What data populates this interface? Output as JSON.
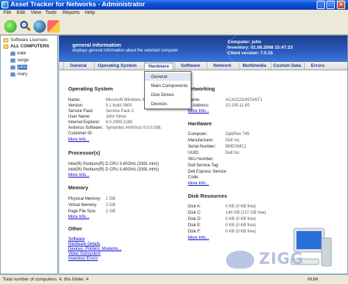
{
  "window": {
    "title": "Asset Tracker for Networks - Administrator"
  },
  "menu": [
    "File",
    "Edit",
    "View",
    "Tools",
    "Reports",
    "Help"
  ],
  "tree": {
    "items": [
      "Software Licenses",
      "ALL COMPUTERS",
      "kate",
      "serge",
      "john",
      "mary"
    ],
    "selected": "john"
  },
  "banner": {
    "title": "general information",
    "subtitle": "displays general information about the selected computer",
    "computer": "Computer: john",
    "inventory": "Inventory: 01.08.2008 15:47:23",
    "client_version": "Client version: 7.0.15"
  },
  "tabs": [
    "General",
    "Operating System",
    "Hardware",
    "Software",
    "Network",
    "Multimedia",
    "Custom Data",
    "Errors"
  ],
  "active_tab": "Hardware",
  "dropdown": [
    "General",
    "Main Components",
    "Disk Drives",
    "Devices"
  ],
  "os": {
    "title": "Operating System",
    "rows": [
      {
        "k": "Name:",
        "v": "Microsoft Windows XP"
      },
      {
        "k": "Version:",
        "v": "5.1 build 2600"
      },
      {
        "k": "Service Pack:",
        "v": "Service Pack 2"
      },
      {
        "k": "User Name:",
        "v": "John Silver"
      },
      {
        "k": "Internet Explorer:",
        "v": "6.0.2900.2180"
      },
      {
        "k": "Antivirus Software:",
        "v": "Symantec AntiVirus 9.0.0.338;"
      },
      {
        "k": "Customer ID:",
        "v": ""
      }
    ]
  },
  "processors": {
    "title": "Processor(s)",
    "rows": [
      "Intel(R) Pentium(R) D CPU 3.40GHz (3391 mHz)",
      "Intel(R) Pentium(R) D CPU 3.40GHz (3391 mHz)"
    ]
  },
  "memory": {
    "title": "Memory",
    "rows": [
      {
        "k": "Physical Memory:",
        "v": "1 GB"
      },
      {
        "k": "Virtual Memory:",
        "v": "2 GB"
      },
      {
        "k": "Page File Size:",
        "v": "2 GB"
      }
    ]
  },
  "other": {
    "title": "Other",
    "links": [
      "Software",
      "Hardware Details",
      "Devices, Printers, Modems...",
      "Video Subsystem",
      "Inventory Errors"
    ]
  },
  "more_info": "More Info...",
  "networking": {
    "title": "Networking",
    "rows": [
      {
        "k": "Name:",
        "v": "ACACCOUNTANT1"
      },
      {
        "k": "IP Address:",
        "v": "10.100.11.65"
      }
    ]
  },
  "hardware": {
    "title": "Hardware",
    "rows": [
      {
        "k": "Computer:",
        "v": "OptiPlex 745"
      },
      {
        "k": "Manufacturer:",
        "v": "Dell Inc."
      },
      {
        "k": "Serial Number:",
        "v": "BMDSMC1"
      },
      {
        "k": "UUID:",
        "v": "Dell Inc."
      },
      {
        "k": "SKU Number:",
        "v": ""
      },
      {
        "k": "Dell Service Tag:",
        "v": ""
      },
      {
        "k": "Dell Express Service",
        "v": ""
      },
      {
        "k": "Code:",
        "v": ""
      }
    ]
  },
  "disks": {
    "title": "Disk Resources",
    "rows": [
      {
        "k": "Disk A:",
        "v": "0 KB (0 KB free)"
      },
      {
        "k": "Disk C:",
        "v": "149 GB (137 GB free)"
      },
      {
        "k": "Disk D:",
        "v": "0 KB (0 KB free)"
      },
      {
        "k": "Disk E:",
        "v": "0 KB (0 KB free)"
      },
      {
        "k": "Disk F:",
        "v": "0 KB (0 KB free)"
      }
    ]
  },
  "status": {
    "text": "Total number of computers: 4, this folder: 4",
    "num": "NUM"
  },
  "watermark": "ZIGG"
}
